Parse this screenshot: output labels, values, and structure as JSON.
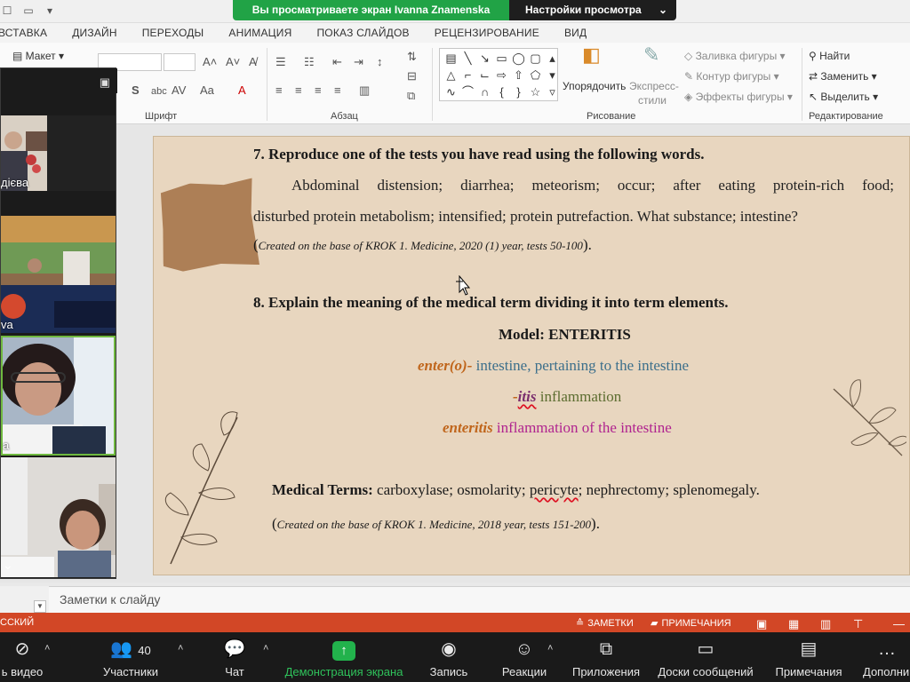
{
  "title_bar": {
    "share_message": "Вы просматриваете экран Ivanna Znamenska",
    "view_options": "Настройки просмотра",
    "view_options_chevron": "⌄"
  },
  "ribbon_tabs": [
    "ВСТАВКА",
    "ДИЗАЙН",
    "ПЕРЕХОДЫ",
    "АНИМАЦИЯ",
    "ПОКАЗ СЛАЙДОВ",
    "РЕЦЕНЗИРОВАНИЕ",
    "ВИД"
  ],
  "ribbon": {
    "layout_label": "Макет",
    "font_group": "Шрифт",
    "paragraph_group": "Абзац",
    "drawing_group": "Рисование",
    "editing_group": "Редактирование",
    "arrange": "Упорядочить",
    "quick_styles_1": "Экспресс-",
    "quick_styles_2": "стили",
    "shape_fill": "Заливка фигуры",
    "shape_outline": "Контур фигуры",
    "shape_effects": "Эффекты фигуры",
    "find": "Найти",
    "replace": "Заменить",
    "select": "Выделить"
  },
  "slide": {
    "task7_heading": "7. Reproduce one of the tests you have read using the following words.",
    "task7_line1": "Abdominal distension; diarrhea; meteorism; occur; after eating protein-rich food;",
    "task7_line2": "disturbed protein metabolism; intensified; protein putrefaction. What substance; intestine?",
    "task7_source": "Created on the base of KROK 1. Medicine, 2020 (1) year, tests 50-100",
    "task8_heading": "8. Explain the meaning of the medical term dividing it into term elements.",
    "model": "Model: ENTERITIS",
    "elem1_term": "enter(o)-",
    "elem1_meaning": "intestine, pertaining to the intestine",
    "elem2_dash": "-",
    "elem2_term": "itis",
    "elem2_meaning": "inflammation",
    "elem3_term": "enteritis",
    "elem3_meaning": "inflammation of the intestine",
    "medical_terms_label": "Medical Terms:",
    "medical_terms_1": "carboxylase; osmolarity;",
    "medical_terms_2": "pericyte",
    "medical_terms_3": "; nephrectomy; splenomegaly.",
    "task8_source": "Created on the base of KROK 1. Medicine, 2018 year, tests 151-200"
  },
  "notes": {
    "placeholder": "Заметки к слайду"
  },
  "status_bar": {
    "language": "ССКИЙ",
    "notes": "ЗАМЕТКИ",
    "comments": "ПРИМЕЧАНИЯ"
  },
  "gallery": {
    "tiles": [
      {
        "name": "дієва"
      },
      {
        "name": "va"
      },
      {
        "name": "a"
      },
      {
        "name": ""
      }
    ]
  },
  "zoom_toolbar": {
    "video": "ь видео",
    "participants": "Участники",
    "participants_count": "40",
    "chat": "Чат",
    "share_screen": "Демонстрация экрана",
    "record": "Запись",
    "reactions": "Реакции",
    "apps": "Приложения",
    "whiteboards": "Доски сообщений",
    "notes": "Примечания",
    "more": "Дополни"
  },
  "colors": {
    "share_green": "#21a346",
    "status_orange": "#d24726",
    "slide_bg": "#e8d6bf",
    "term_orange": "#c0661c",
    "meaning_blue": "#3c6f8b",
    "meaning_green": "#5b6c2f",
    "meaning_magenta": "#b0238f"
  }
}
